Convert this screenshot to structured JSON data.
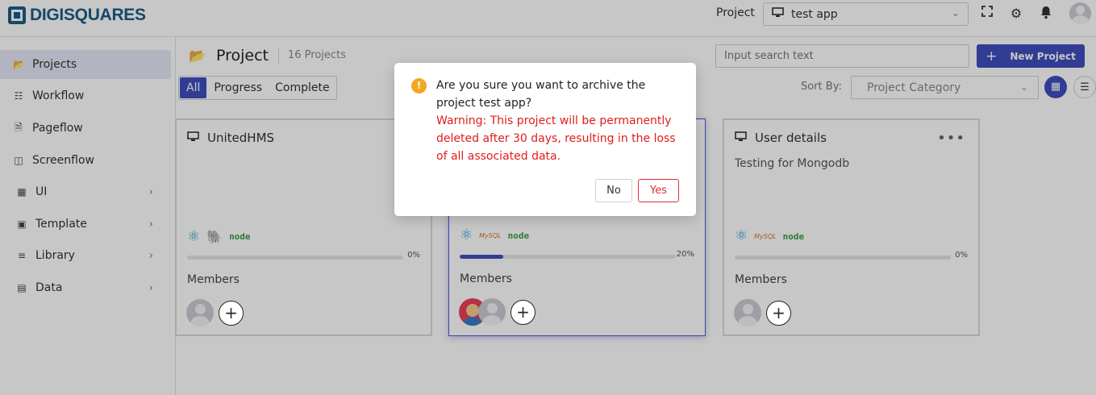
{
  "brand": {
    "name": "DIGISQUARES"
  },
  "topbar": {
    "project_label": "Project",
    "project_selected": "test app"
  },
  "sidebar": {
    "items": [
      {
        "label": "Projects"
      },
      {
        "label": "Workflow"
      },
      {
        "label": "Pageflow"
      },
      {
        "label": "Screenflow"
      },
      {
        "label": "UI"
      },
      {
        "label": "Template"
      },
      {
        "label": "Library"
      },
      {
        "label": "Data"
      }
    ]
  },
  "main": {
    "title": "Project",
    "count": "16 Projects",
    "search_placeholder": "Input search text",
    "new_button": "New Project",
    "filters": [
      "All",
      "Progress",
      "Complete"
    ],
    "sort_label": "Sort By:",
    "sort_value": "Project Category"
  },
  "cards": [
    {
      "title": "UnitedHMS",
      "description": "",
      "progress_label": "0%",
      "progress": 0,
      "members_label": "Members"
    },
    {
      "title": "",
      "description": "",
      "progress_label": "20%",
      "progress": 0.2,
      "members_label": "Members"
    },
    {
      "title": "User details",
      "description": "Testing for Mongodb",
      "progress_label": "0%",
      "progress": 0,
      "members_label": "Members"
    }
  ],
  "tech_labels": {
    "node": "node",
    "mysql": "MySQL"
  },
  "modal": {
    "question": "Are you sure you want to archive the project test app?",
    "warning": "Warning: This project will be permanently deleted after 30 days, resulting in the loss of all associated data.",
    "no": "No",
    "yes": "Yes"
  },
  "colors": {
    "accent": "#3f4ebf",
    "danger": "#e21b1b",
    "warn": "#f5a623",
    "brand": "#1a5d88"
  }
}
